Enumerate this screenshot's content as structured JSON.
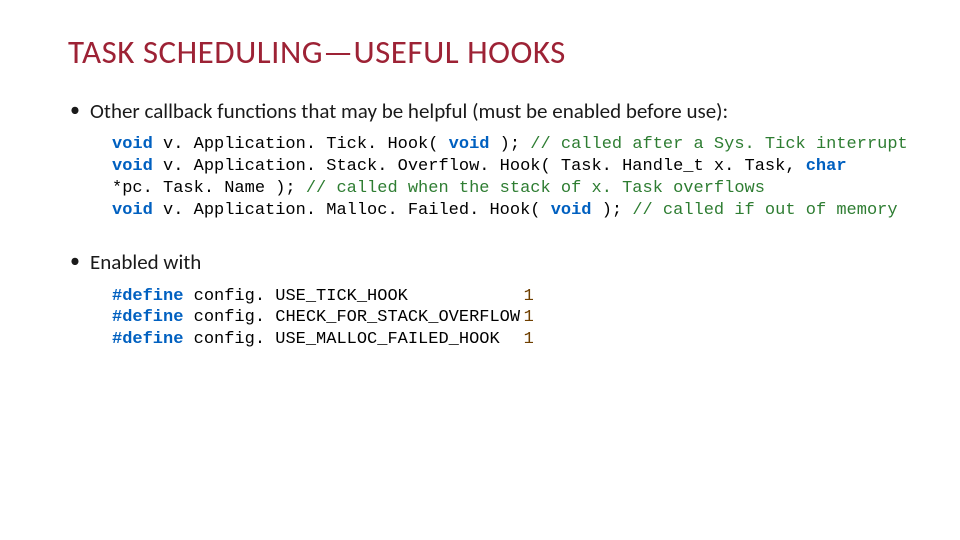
{
  "title": "TASK SCHEDULING—USEFUL HOOKS",
  "bullet1": "Other callback functions that may be helpful (must be enabled before use):",
  "bullet2": "Enabled with",
  "code1": {
    "l1_kw1": "void",
    "l1_txt1": " v. Application. Tick. Hook( ",
    "l1_kw2": "void",
    "l1_txt2": " ); ",
    "l1_cmt": "// called after a Sys. Tick interrupt",
    "l2_kw1": "void",
    "l2_txt1": " v. Application. Stack. Overflow. Hook( Task. Handle_t x. Task, ",
    "l2_kw2": "char",
    "l3_txt1": "*pc. Task. Name ); ",
    "l3_cmt": "// called when the stack of x. Task overflows",
    "l4_kw1": "void",
    "l4_txt1": " v. Application. Malloc. Failed. Hook( ",
    "l4_kw2": "void",
    "l4_txt2": " ); ",
    "l4_cmt": "// called if out of memory"
  },
  "code2": {
    "r1_def": "#define",
    "r1_name": "config. USE_TICK_HOOK",
    "r1_val": "1",
    "r2_def": "#define",
    "r2_name": "config. CHECK_FOR_STACK_OVERFLOW",
    "r2_val": "1",
    "r3_def": "#define",
    "r3_name": "config. USE_MALLOC_FAILED_HOOK",
    "r3_val": "1"
  }
}
